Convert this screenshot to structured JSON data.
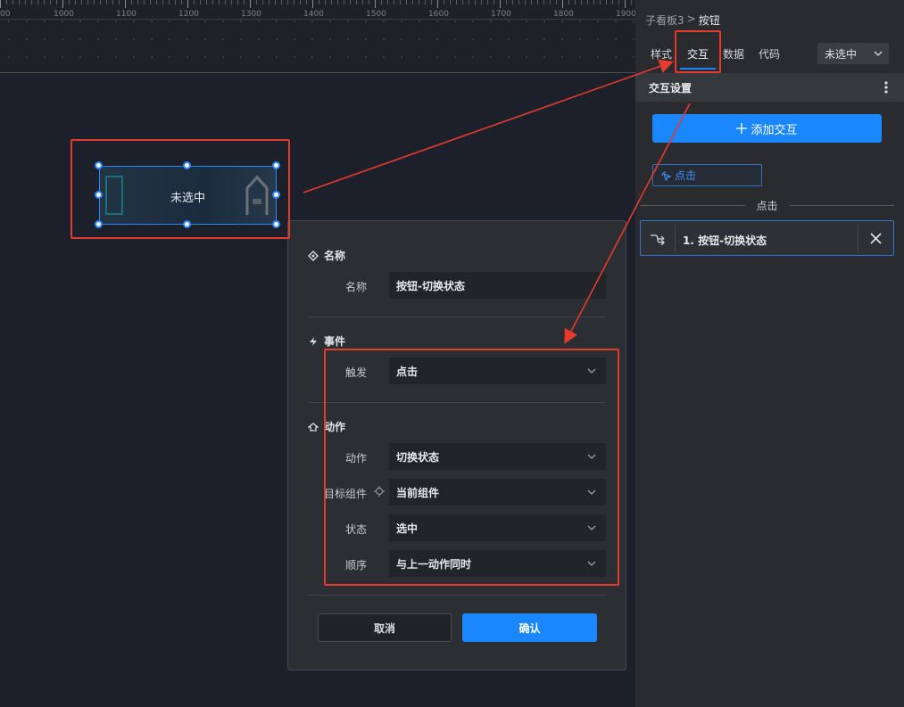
{
  "ruler": {
    "labels": [
      "00",
      "1000",
      "1100",
      "1200",
      "1300",
      "1400",
      "1500",
      "1600",
      "1700",
      "1800",
      "1900"
    ]
  },
  "widget": {
    "label": "未选中"
  },
  "dialog": {
    "name_section": "名称",
    "name_label": "名称",
    "name_value": "按钮-切换状态",
    "event_section": "事件",
    "trigger_label": "触发",
    "trigger_value": "点击",
    "action_section": "动作",
    "action_label": "动作",
    "action_value": "切换状态",
    "target_label": "目标组件",
    "target_value": "当前组件",
    "state_label": "状态",
    "state_value": "选中",
    "order_label": "顺序",
    "order_value": "与上一动作同时",
    "cancel": "取消",
    "confirm": "确认"
  },
  "panel": {
    "breadcrumb_parent": "子看板3",
    "breadcrumb_sep": ">",
    "breadcrumb_current": "按钮",
    "tabs": [
      "样式",
      "交互",
      "数据",
      "代码"
    ],
    "active_tab": "交互",
    "state_select": "未选中",
    "section_title": "交互设置",
    "add_button": "添加交互",
    "event_chip": "点击",
    "event_group": "点击",
    "action_item": "1. 按钮-切换状态"
  },
  "colors": {
    "accent": "#1b87ff",
    "annotation": "#e63a2e"
  }
}
